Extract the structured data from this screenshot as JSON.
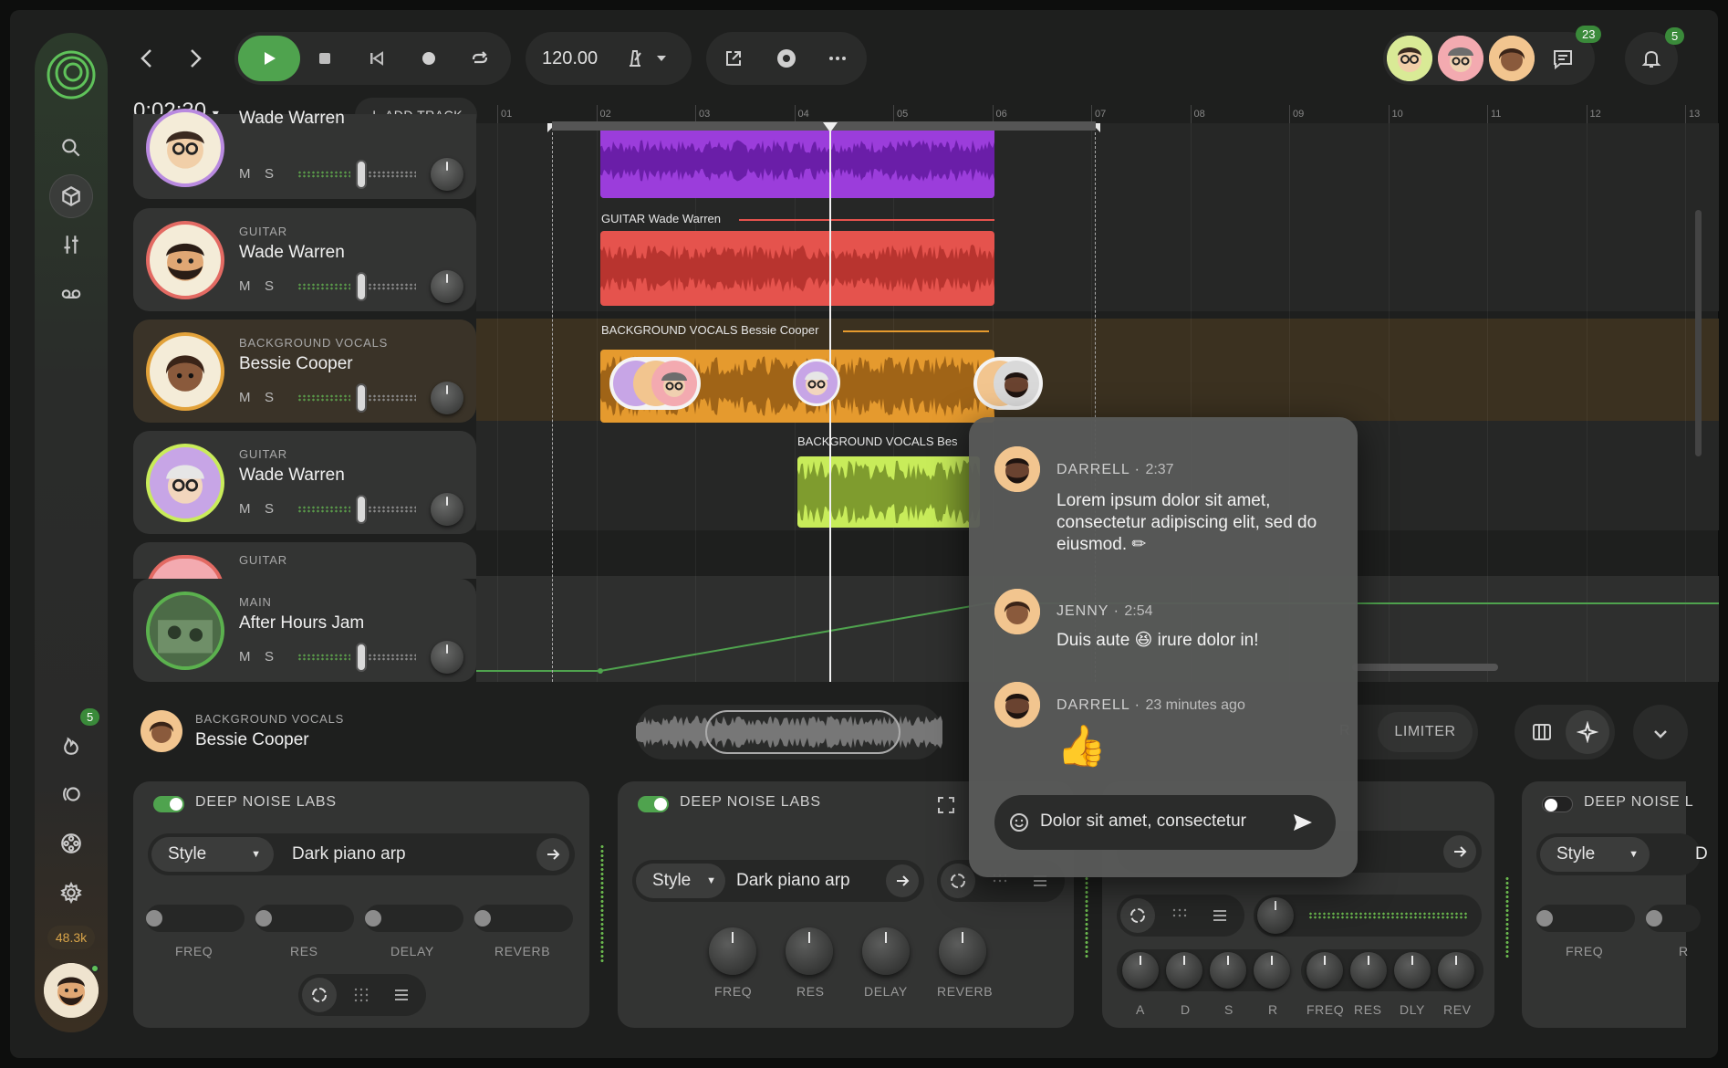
{
  "app": {
    "time": "0:02:30",
    "tempo": "120.00",
    "add_track_label": "ADD TRACK",
    "sidebar_badge": "5",
    "sidebar_count": "48.3k",
    "messages_badge": "23",
    "notifications_badge": "5"
  },
  "ruler": [
    "01",
    "02",
    "03",
    "04",
    "05",
    "06",
    "07",
    "08",
    "09",
    "10",
    "11",
    "12",
    "13"
  ],
  "tracks": [
    {
      "type": "",
      "name": "Wade Warren",
      "ring": "#b98ae0"
    },
    {
      "type": "GUITAR",
      "name": "Wade Warren",
      "ring": "#e36a63"
    },
    {
      "type": "BACKGROUND VOCALS",
      "name": "Bessie Cooper",
      "ring": "#e2a23a"
    },
    {
      "type": "GUITAR",
      "name": "Wade Warren",
      "ring": "#c9ec5a"
    },
    {
      "type": "GUITAR",
      "name": "",
      "ring": "#e36a63"
    },
    {
      "type": "MAIN",
      "name": "After Hours Jam",
      "ring": "#5bb14e"
    }
  ],
  "mute_label": "M",
  "solo_label": "S",
  "clips": {
    "guitar_label": "GUITAR Wade Warren",
    "bgvocals_label": "BACKGROUND VOCALS Bessie Cooper",
    "bgvocals2_label": "BACKGROUND VOCALS Bes"
  },
  "selected_track": {
    "type": "BACKGROUND VOCALS",
    "name": "Bessie Cooper"
  },
  "right_controls": {
    "limiter": "LIMITER",
    "partial": "R"
  },
  "fx": [
    {
      "title": "DEEP NOISE LABS",
      "style": "Style",
      "preset": "Dark piano arp",
      "labels": [
        "FREQ",
        "RES",
        "DELAY",
        "REVERB"
      ]
    },
    {
      "title": "DEEP NOISE LABS",
      "style": "Style",
      "preset": "Dark piano arp",
      "labels": [
        "FREQ",
        "RES",
        "DELAY",
        "REVERB"
      ]
    },
    {
      "title": "",
      "labels": [
        "A",
        "D",
        "S",
        "R",
        "FREQ",
        "RES",
        "DLY",
        "REV"
      ]
    },
    {
      "title": "DEEP NOISE L",
      "style": "Style",
      "preset": "D",
      "labels": [
        "FREQ",
        "R"
      ]
    }
  ],
  "chat": {
    "messages": [
      {
        "author": "DARRELL",
        "time": "2:37",
        "text": "Lorem ipsum dolor sit amet, consectetur adipiscing elit, sed do eiusmod. ✏"
      },
      {
        "author": "JENNY",
        "time": "2:54",
        "text": "Duis aute 😆 irure dolor in!"
      },
      {
        "author": "DARRELL",
        "time": "23 minutes ago",
        "text": "👍"
      }
    ],
    "input_value": "Dolor sit amet, consectetur"
  },
  "colors": {
    "accent": "#4fa34e",
    "purple": "#9b3ddb",
    "red": "#e5534d",
    "orange": "#e59a2e",
    "lime": "#c8ec5a"
  }
}
